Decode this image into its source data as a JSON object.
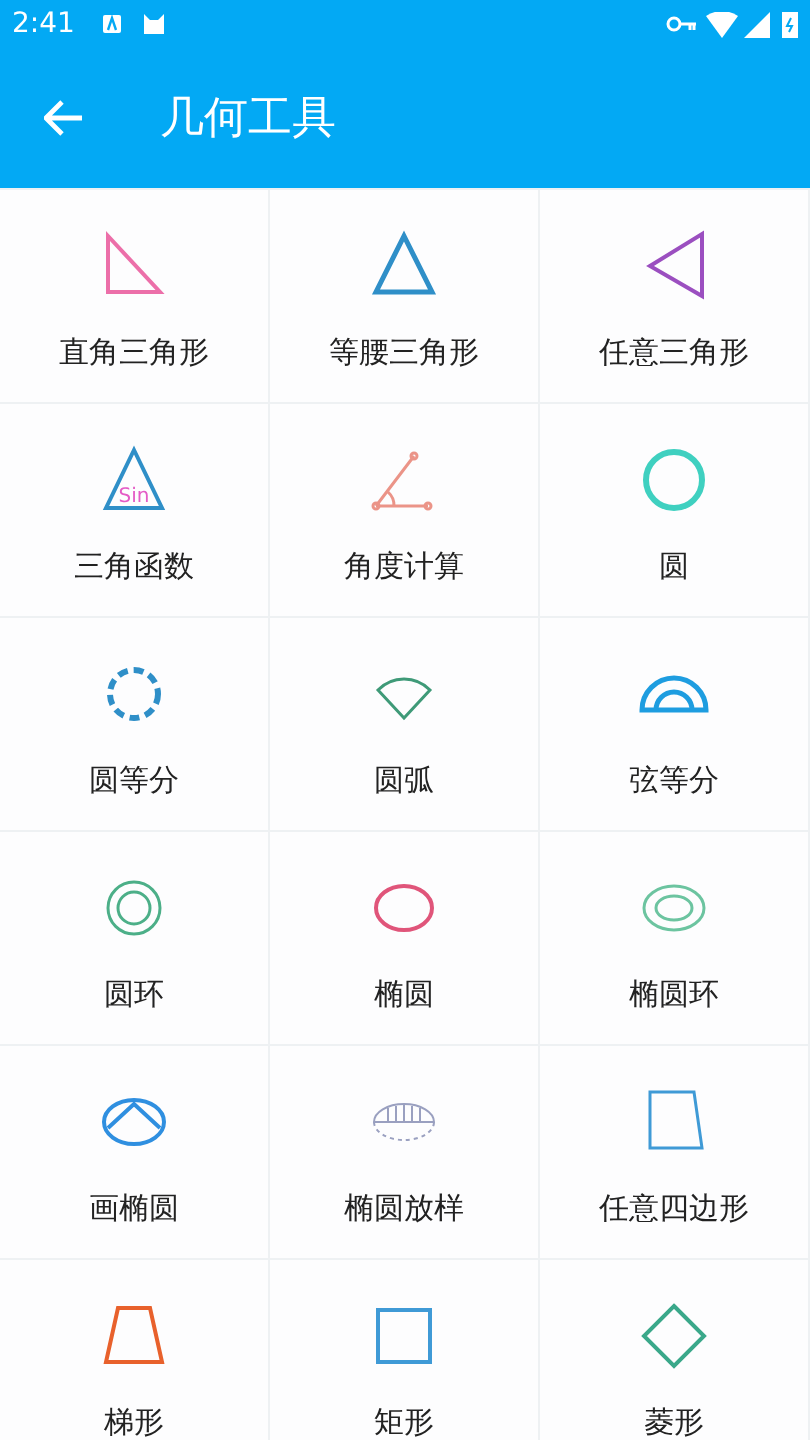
{
  "status_bar": {
    "time": "2:41"
  },
  "app_bar": {
    "title": "几何工具"
  },
  "tools": [
    {
      "kind": "right-triangle",
      "label": "直角三角形"
    },
    {
      "kind": "isosceles-triangle",
      "label": "等腰三角形"
    },
    {
      "kind": "left-triangle",
      "label": "任意三角形"
    },
    {
      "kind": "sin-triangle",
      "label": "三角函数",
      "icon_text": "Sin"
    },
    {
      "kind": "angle",
      "label": "角度计算"
    },
    {
      "kind": "circle",
      "label": "圆"
    },
    {
      "kind": "dashed-circle",
      "label": "圆等分"
    },
    {
      "kind": "sector",
      "label": "圆弧"
    },
    {
      "kind": "protractor",
      "label": "弦等分"
    },
    {
      "kind": "ring",
      "label": "圆环"
    },
    {
      "kind": "ellipse",
      "label": "椭圆"
    },
    {
      "kind": "ellipse-ring",
      "label": "椭圆环"
    },
    {
      "kind": "ellipse-arc",
      "label": "画椭圆"
    },
    {
      "kind": "hatched-ellipse",
      "label": "椭圆放样"
    },
    {
      "kind": "quadrilateral",
      "label": "任意四边形"
    },
    {
      "kind": "trapezoid",
      "label": "梯形"
    },
    {
      "kind": "square",
      "label": "矩形"
    },
    {
      "kind": "diamond",
      "label": "菱形"
    }
  ]
}
